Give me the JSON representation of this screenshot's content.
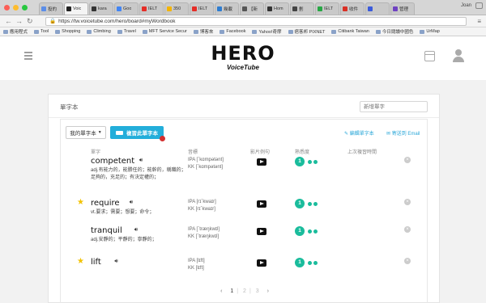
{
  "browser": {
    "tabs": [
      {
        "label": "投的",
        "color": "#5b8de8"
      },
      {
        "label": "Voic",
        "color": "#222222",
        "active": true
      },
      {
        "label": "kara",
        "color": "#333333"
      },
      {
        "label": "Goo",
        "color": "#4285f4"
      },
      {
        "label": "IELT",
        "color": "#e52d27"
      },
      {
        "label": "350",
        "color": "#f4b400"
      },
      {
        "label": "IELT",
        "color": "#e52d27"
      },
      {
        "label": "幾載",
        "color": "#2e7dd1"
      },
      {
        "label": "【新",
        "color": "#555555"
      },
      {
        "label": "Hom",
        "color": "#333333"
      },
      {
        "label": "劃",
        "color": "#444444"
      },
      {
        "label": "IELT",
        "color": "#28a745"
      },
      {
        "label": "收件",
        "color": "#d93025"
      },
      {
        "label": "",
        "color": "#3b5bdb"
      },
      {
        "label": "管理",
        "color": "#6f42c1"
      }
    ],
    "user_name": "Joan",
    "url": "https://tw.voicetube.com/hero/board#myWordbook",
    "bookmarks": [
      {
        "label": "應用程式"
      },
      {
        "label": "Tool"
      },
      {
        "label": "Shopping"
      },
      {
        "label": "Climbing"
      },
      {
        "label": "Travel"
      },
      {
        "label": "MFT Service Secur"
      },
      {
        "label": "博客來"
      },
      {
        "label": "Facebook"
      },
      {
        "label": "Yahoo!奇摩"
      },
      {
        "label": "痞客邦 PIXNET"
      },
      {
        "label": "Citibank Taiwan"
      },
      {
        "label": "今日閱讀中國色"
      },
      {
        "label": "UrMap"
      }
    ]
  },
  "header": {
    "logo": "HERO",
    "logo_sub": "VoiceTube"
  },
  "wordbook": {
    "title": "單字本",
    "search_placeholder": "新增單字",
    "dropdown_label": "我的單字本",
    "review_button": "複習此單字本",
    "edit_link": "編輯單字本",
    "email_link": "寄送到 Email",
    "columns": {
      "word": "單字",
      "phonetic": "音標",
      "video": "影片例句",
      "familiarity": "熟悉度",
      "last_review": "上次複習時間"
    },
    "rows": [
      {
        "word": "competent",
        "starred": false,
        "definition": "adj.有能力的，能勝任的；能幹的，稱職的；足夠的，充足的；有決定權的；",
        "ipa": "IPA [ˋkɑmpətənt]",
        "kk": "KK [ˋkɑmpətənt]",
        "familiarity": "1"
      },
      {
        "word": "require",
        "starred": true,
        "definition": "vt.要求；需要；想要；命令；",
        "ipa": "IPA [rɪˋkwaɪr]",
        "kk": "KK [rɪˋkwaɪr]",
        "familiarity": "1"
      },
      {
        "word": "tranquil",
        "starred": false,
        "definition": "adj.安靜的；平靜的；寧靜的；",
        "ipa": "IPA [ˋtræŋkwɪl]",
        "kk": "KK [ˋtræŋkwɪl]",
        "familiarity": "1"
      },
      {
        "word": "lift",
        "starred": true,
        "definition": "",
        "ipa": "IPA [lɪft]",
        "kk": "KK [lɪft]",
        "familiarity": "1"
      }
    ],
    "pagination": {
      "prev": "‹",
      "pages": [
        "1",
        "2",
        "3"
      ],
      "current": "1",
      "next": "›"
    }
  },
  "colors": {
    "accent": "#23aeda",
    "familiarity": "#1abc9c",
    "star": "#f2c200",
    "alert_dot": "#d32f2f"
  }
}
